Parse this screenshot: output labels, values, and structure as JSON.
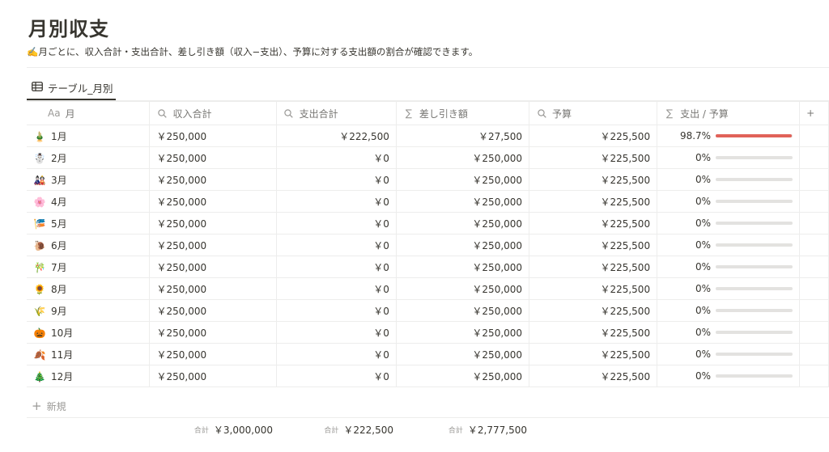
{
  "page": {
    "title": "月別収支",
    "description": "✍️月ごとに、収入合計・支出合計、差し引き額（収入−支出）、予算に対する支出額の割合が確認できます。"
  },
  "view_tab": {
    "label": "テーブル_月別",
    "icon": "table-icon"
  },
  "columns": [
    {
      "label": "月",
      "icon": "Aa",
      "icon_name": "title-property-icon"
    },
    {
      "label": "収入合計",
      "icon": "search-icon"
    },
    {
      "label": "支出合計",
      "icon": "search-icon"
    },
    {
      "label": "差し引き額",
      "icon": "sigma-icon"
    },
    {
      "label": "予算",
      "icon": "search-icon"
    },
    {
      "label": "支出 / 予算",
      "icon": "sigma-icon"
    }
  ],
  "add_column_label": "+",
  "rows": [
    {
      "emoji": "🎍",
      "month": "1月",
      "income": "￥250,000",
      "expense": "￥222,500",
      "diff": "￥27,500",
      "budget": "￥225,500",
      "ratio": "98.7%",
      "ratio_value": 0.987
    },
    {
      "emoji": "☃️",
      "month": "2月",
      "income": "￥250,000",
      "expense": "￥0",
      "diff": "￥250,000",
      "budget": "￥225,500",
      "ratio": "0%",
      "ratio_value": 0
    },
    {
      "emoji": "🎎",
      "month": "3月",
      "income": "￥250,000",
      "expense": "￥0",
      "diff": "￥250,000",
      "budget": "￥225,500",
      "ratio": "0%",
      "ratio_value": 0
    },
    {
      "emoji": "🌸",
      "month": "4月",
      "income": "￥250,000",
      "expense": "￥0",
      "diff": "￥250,000",
      "budget": "￥225,500",
      "ratio": "0%",
      "ratio_value": 0
    },
    {
      "emoji": "🎏",
      "month": "5月",
      "income": "￥250,000",
      "expense": "￥0",
      "diff": "￥250,000",
      "budget": "￥225,500",
      "ratio": "0%",
      "ratio_value": 0
    },
    {
      "emoji": "🐌",
      "month": "6月",
      "income": "￥250,000",
      "expense": "￥0",
      "diff": "￥250,000",
      "budget": "￥225,500",
      "ratio": "0%",
      "ratio_value": 0
    },
    {
      "emoji": "🎋",
      "month": "7月",
      "income": "￥250,000",
      "expense": "￥0",
      "diff": "￥250,000",
      "budget": "￥225,500",
      "ratio": "0%",
      "ratio_value": 0
    },
    {
      "emoji": "🌻",
      "month": "8月",
      "income": "￥250,000",
      "expense": "￥0",
      "diff": "￥250,000",
      "budget": "￥225,500",
      "ratio": "0%",
      "ratio_value": 0
    },
    {
      "emoji": "🌾",
      "month": "9月",
      "income": "￥250,000",
      "expense": "￥0",
      "diff": "￥250,000",
      "budget": "￥225,500",
      "ratio": "0%",
      "ratio_value": 0
    },
    {
      "emoji": "🎃",
      "month": "10月",
      "income": "￥250,000",
      "expense": "￥0",
      "diff": "￥250,000",
      "budget": "￥225,500",
      "ratio": "0%",
      "ratio_value": 0
    },
    {
      "emoji": "🍂",
      "month": "11月",
      "income": "￥250,000",
      "expense": "￥0",
      "diff": "￥250,000",
      "budget": "￥225,500",
      "ratio": "0%",
      "ratio_value": 0
    },
    {
      "emoji": "🎄",
      "month": "12月",
      "income": "￥250,000",
      "expense": "￥0",
      "diff": "￥250,000",
      "budget": "￥225,500",
      "ratio": "0%",
      "ratio_value": 0
    }
  ],
  "new_row_label": "新規",
  "summary": {
    "label": "合計",
    "income_total": "￥3,000,000",
    "expense_total": "￥222,500",
    "diff_total": "￥2,777,500"
  },
  "colors": {
    "progress_fill": "#e16259",
    "progress_track": "#e3e2e0",
    "text": "#37352f",
    "muted": "#9b9a97"
  }
}
